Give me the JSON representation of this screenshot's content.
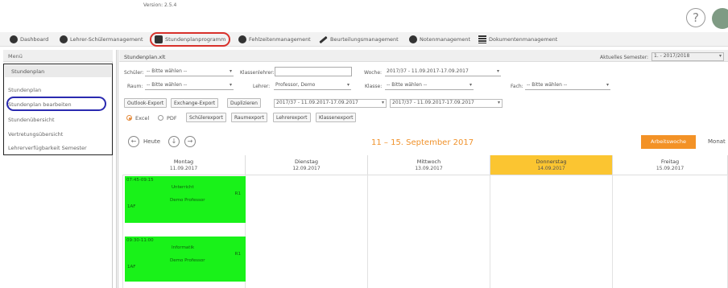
{
  "app": {
    "version": "Version: 2.5.4",
    "help_icon": "?",
    "avatar": "user-avatar"
  },
  "nav": {
    "items": [
      {
        "label": "Dashboard",
        "icon": "people-icon"
      },
      {
        "label": "Lehrer-Schülermanagement",
        "icon": "people-icon"
      },
      {
        "label": "Stundenplanprogramm",
        "icon": "calendar-icon"
      },
      {
        "label": "Fehlzeitenmanagement",
        "icon": "person-icon"
      },
      {
        "label": "Beurteilungsmanagement",
        "icon": "pen-icon"
      },
      {
        "label": "Notenmanagement",
        "icon": "award-icon"
      },
      {
        "label": "Dokumentenmanagement",
        "icon": "list-icon"
      }
    ]
  },
  "sidebar": {
    "header": "Menü",
    "section_title": "Stundenplan",
    "items": [
      {
        "label": "Stundenplan"
      },
      {
        "label": "Stundenplan bearbeiten"
      },
      {
        "label": "Stundenübersicht"
      },
      {
        "label": "Vertretungsübersicht"
      },
      {
        "label": "Lehrerverfügbarkeit Semester"
      }
    ]
  },
  "content": {
    "title": "Stundenplan.xlt",
    "semester_label": "Aktuelles Semester:",
    "semester_value": "1. - 2017/2018"
  },
  "filters": {
    "schueler_label": "Schüler:",
    "schueler_value": "-- Bitte wählen --",
    "klassenlehrer_label": "Klassenlehrer:",
    "woche_label": "Woche:",
    "woche_value": "2017/37 - 11.09.2017-17.09.2017",
    "raum_label": "Raum:",
    "raum_value": "-- Bitte wählen --",
    "lehrer_label": "Lehrer:",
    "lehrer_value": "Professor, Demo",
    "klasse_label": "Klasse:",
    "klasse_value": "-- Bitte wählen --",
    "fach_label": "Fach:",
    "fach_value": "-- Bitte wählen --"
  },
  "export": {
    "outlook": "Outlook-Export",
    "exchange": "Exchange-Export",
    "duplicate": "Duplizieren",
    "from_week": "2017/37 - 11.09.2017-17.09.2017",
    "to_week": "2017/37 - 11.09.2017-17.09.2017",
    "excel": "Excel",
    "pdf": "PDF",
    "schueler": "Schülerexport",
    "raum": "Raumexport",
    "lehrer": "Lehrerexport",
    "klassen": "Klassenexport"
  },
  "calendar": {
    "today_label": "Heute",
    "range": "11 – 15. September 2017",
    "view_week": "Arbeitswoche",
    "view_month": "Monat",
    "days": [
      {
        "name": "Montag",
        "date": "11.09.2017"
      },
      {
        "name": "Dienstag",
        "date": "12.09.2017"
      },
      {
        "name": "Mittwoch",
        "date": "13.09.2017"
      },
      {
        "name": "Donnerstag",
        "date": "14.09.2017"
      },
      {
        "name": "Freitag",
        "date": "15.09.2017"
      }
    ],
    "events": [
      {
        "time": "07:45-09:15",
        "subject": "Unterricht",
        "teacher": "Demo Professor",
        "room": "R1",
        "class": "1AF"
      },
      {
        "time": "09:30-11:00",
        "subject": "Informatik",
        "teacher": "Demo Professor",
        "room": "R1",
        "class": "1AF"
      }
    ]
  }
}
